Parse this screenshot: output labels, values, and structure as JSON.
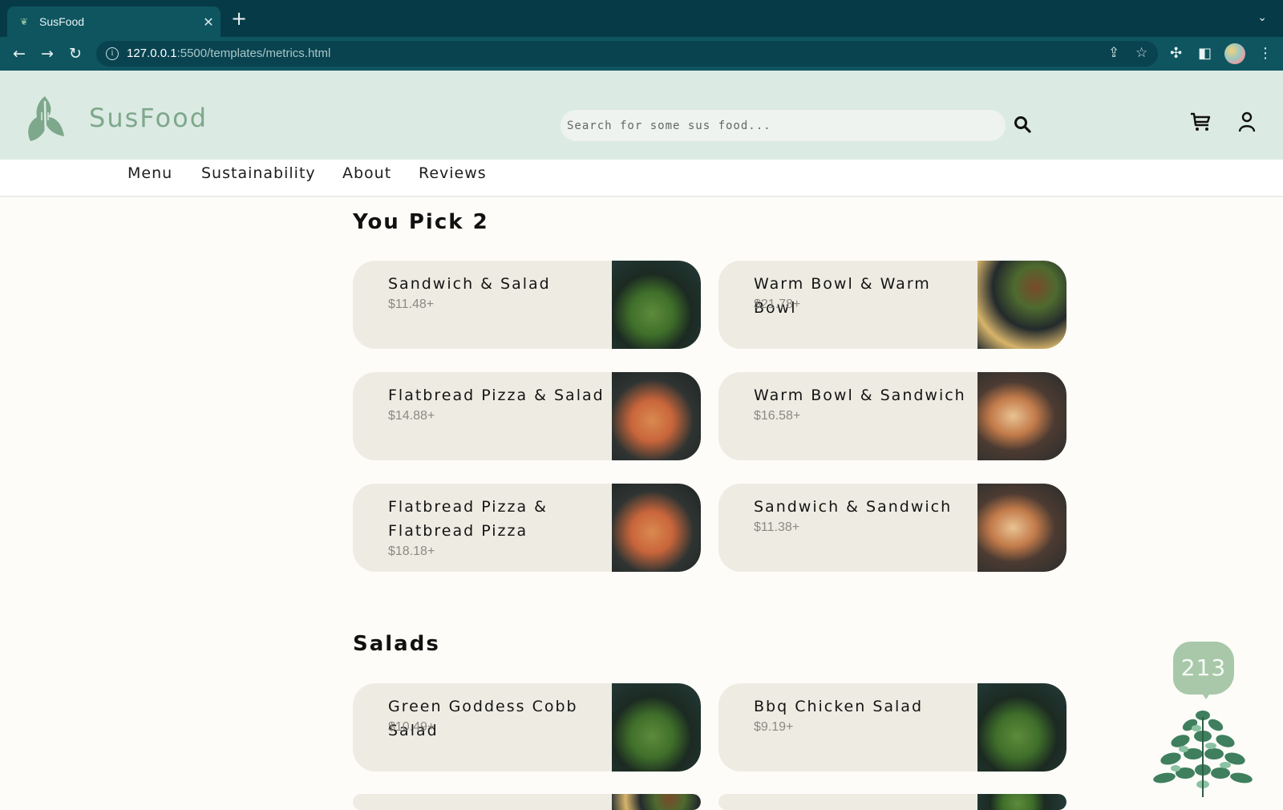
{
  "browser": {
    "tab_title": "SusFood",
    "tab_close": "✕",
    "new_tab": "+",
    "url_host": "127.0.0.1",
    "url_rest": ":5500/templates/metrics.html"
  },
  "header": {
    "brand": "SusFood",
    "search_placeholder": "Search for some sus food..."
  },
  "nav": {
    "items": [
      "Menu",
      "Sustainability",
      "About",
      "Reviews"
    ]
  },
  "sections": [
    {
      "title": "You Pick 2",
      "items": [
        {
          "name": "Sandwich & Salad",
          "price": "$11.48+",
          "image": "sandwich-salad-photo"
        },
        {
          "name": "Warm Bowl & Warm Bowl",
          "price": "$21.78+",
          "image": "warm-bowls-photo"
        },
        {
          "name": "Flatbread Pizza & Salad",
          "price": "$14.88+",
          "image": "flatbread-salad-photo"
        },
        {
          "name": "Warm Bowl & Sandwich",
          "price": "$16.58+",
          "image": "bowl-sandwich-photo"
        },
        {
          "name": "Flatbread Pizza & Flatbread Pizza",
          "price": "$18.18+",
          "image": "flatbread-flatbread-photo"
        },
        {
          "name": "Sandwich & Sandwich",
          "price": "$11.38+",
          "image": "sandwich-sandwich-photo"
        }
      ]
    },
    {
      "title": "Salads",
      "items": [
        {
          "name": "Green Goddess Cobb Salad",
          "price": "$10.49+",
          "image": "cobb-salad-photo"
        },
        {
          "name": "Bbq Chicken Salad",
          "price": "$9.19+",
          "image": "bbq-salad-photo"
        }
      ]
    }
  ],
  "widget": {
    "counter": "213"
  }
}
